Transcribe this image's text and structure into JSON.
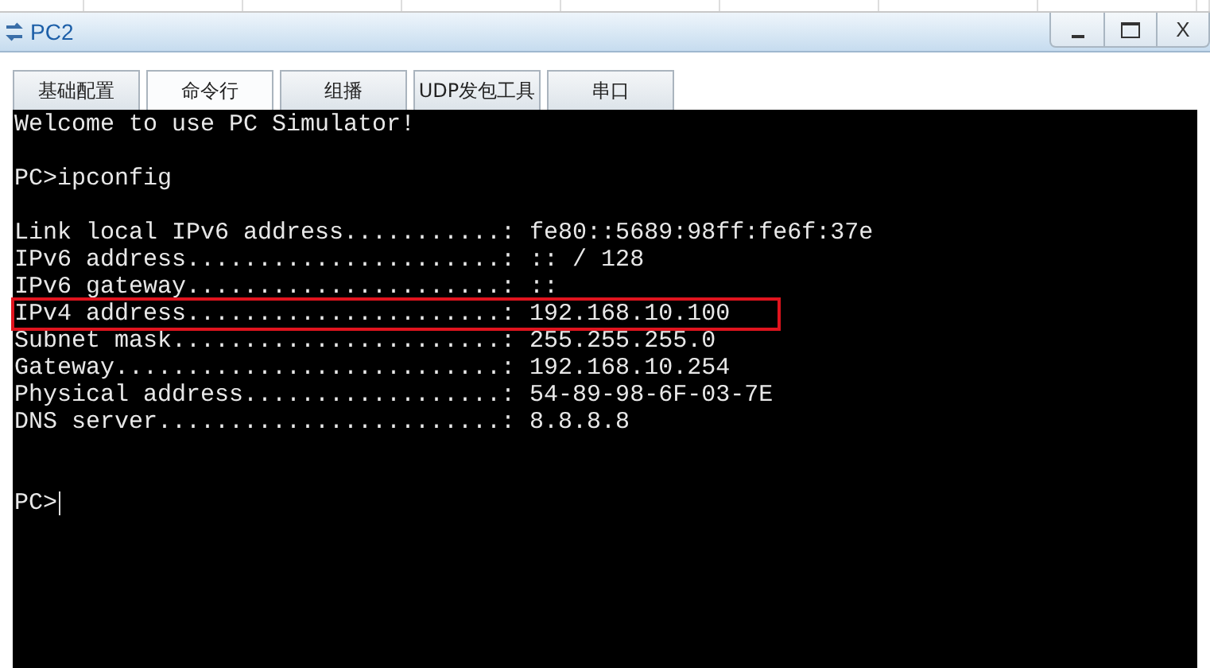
{
  "window": {
    "title": "PC2",
    "close_label": "X"
  },
  "tabs": [
    {
      "label": "基础配置",
      "selected": false
    },
    {
      "label": "命令行",
      "selected": true
    },
    {
      "label": "组播",
      "selected": false
    },
    {
      "label": "UDP发包工具",
      "selected": false
    },
    {
      "label": "串口",
      "selected": false
    }
  ],
  "terminal": {
    "welcome": "Welcome to use PC Simulator!",
    "command": "PC>ipconfig",
    "output": [
      {
        "text": "Link local IPv6 address...........: fe80::5689:98ff:fe6f:37e",
        "highlighted": false
      },
      {
        "text": "IPv6 address......................: :: / 128",
        "highlighted": false
      },
      {
        "text": "IPv6 gateway......................: ::",
        "highlighted": false
      },
      {
        "text": "IPv4 address......................: 192.168.10.100",
        "highlighted": true
      },
      {
        "text": "Subnet mask.......................: 255.255.255.0",
        "highlighted": false
      },
      {
        "text": "Gateway...........................: 192.168.10.254",
        "highlighted": false
      },
      {
        "text": "Physical address..................: 54-89-98-6F-03-7E",
        "highlighted": false
      },
      {
        "text": "DNS server........................: 8.8.8.8",
        "highlighted": false
      }
    ],
    "prompt": "PC>"
  }
}
